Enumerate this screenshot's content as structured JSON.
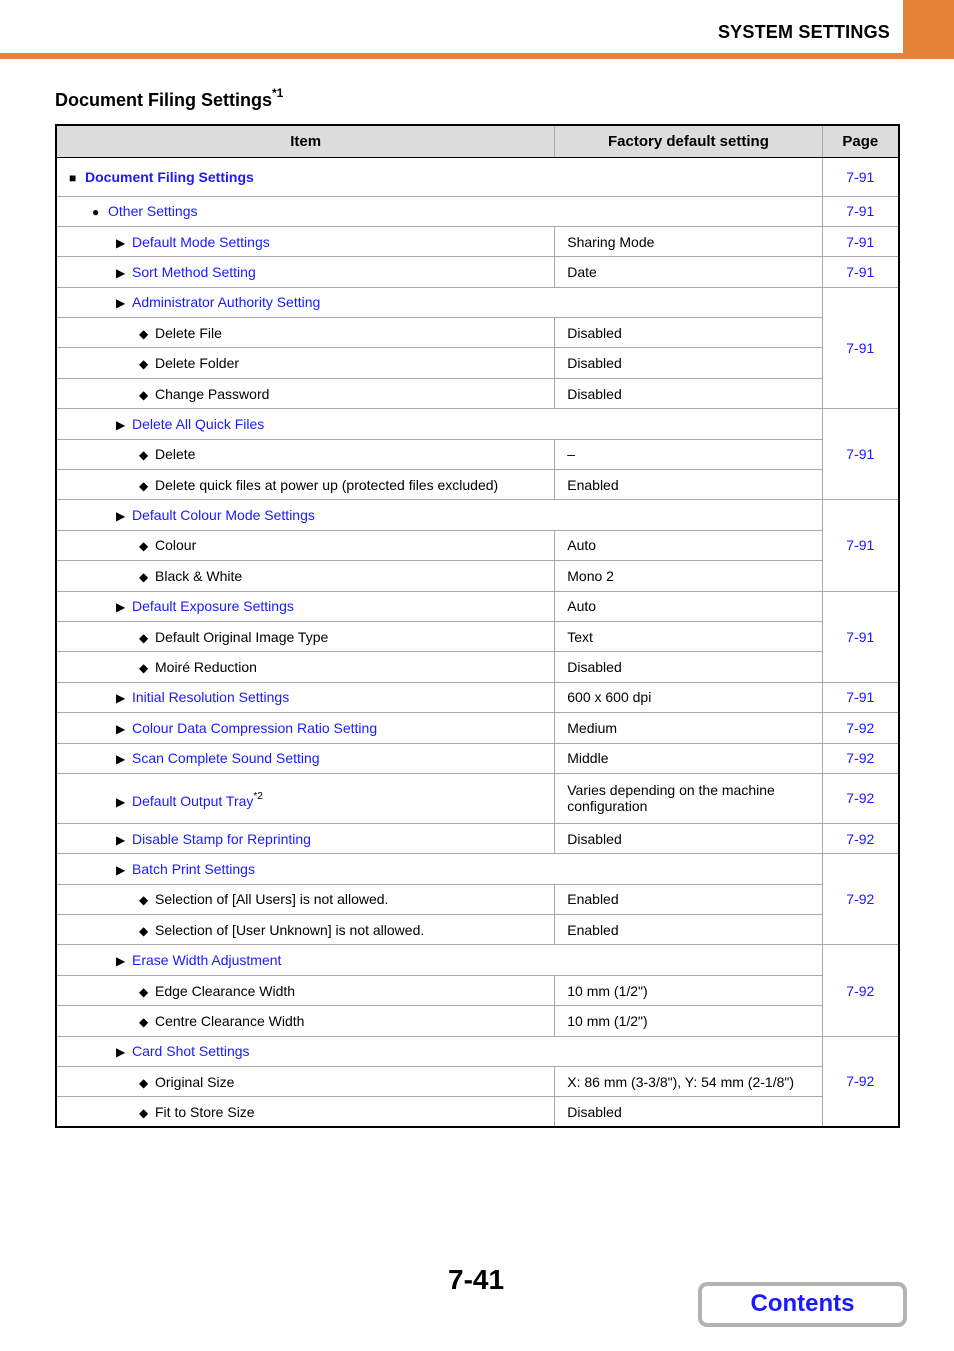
{
  "header": {
    "title": "SYSTEM SETTINGS",
    "accent_color": "#e5823a"
  },
  "section": {
    "title": "Document Filing Settings",
    "footnote_marker": "*1"
  },
  "table": {
    "columns": [
      "Item",
      "Factory default setting",
      "Page"
    ],
    "rows": [
      {
        "bullet": "■",
        "label": "Document Filing Settings",
        "link": true,
        "default": "",
        "page": "7-91"
      },
      {
        "bullet": "●",
        "label": "Other Settings",
        "link": true,
        "default": "",
        "page": "7-91"
      },
      {
        "bullet": "▶",
        "label": "Default Mode Settings",
        "link": true,
        "default": "Sharing Mode",
        "page": "7-91"
      },
      {
        "bullet": "▶",
        "label": "Sort Method Setting",
        "link": true,
        "default": "Date",
        "page": "7-91"
      },
      {
        "bullet": "▶",
        "label": "Administrator Authority Setting",
        "link": true,
        "default": "",
        "page": "7-91"
      },
      {
        "bullet": "◆",
        "label": "Delete File",
        "link": false,
        "default": "Disabled"
      },
      {
        "bullet": "◆",
        "label": "Delete Folder",
        "link": false,
        "default": "Disabled"
      },
      {
        "bullet": "◆",
        "label": "Change Password",
        "link": false,
        "default": "Disabled"
      },
      {
        "bullet": "▶",
        "label": "Delete All Quick Files",
        "link": true,
        "default": "",
        "page": "7-91"
      },
      {
        "bullet": "◆",
        "label": "Delete",
        "link": false,
        "default": "–"
      },
      {
        "bullet": "◆",
        "label": "Delete quick files at power up (protected files excluded)",
        "link": false,
        "default": "Enabled"
      },
      {
        "bullet": "▶",
        "label": "Default Colour Mode Settings",
        "link": true,
        "default": "",
        "page": "7-91"
      },
      {
        "bullet": "◆",
        "label": "Colour",
        "link": false,
        "default": "Auto"
      },
      {
        "bullet": "◆",
        "label": "Black & White",
        "link": false,
        "default": "Mono 2"
      },
      {
        "bullet": "▶",
        "label": "Default Exposure Settings",
        "link": true,
        "default": "Auto",
        "page": "7-91"
      },
      {
        "bullet": "◆",
        "label": "Default Original Image Type",
        "link": false,
        "default": "Text"
      },
      {
        "bullet": "◆",
        "label": "Moiré Reduction",
        "link": false,
        "default": "Disabled"
      },
      {
        "bullet": "▶",
        "label": "Initial Resolution Settings",
        "link": true,
        "default": "600 x 600 dpi",
        "page": "7-91"
      },
      {
        "bullet": "▶",
        "label": "Colour Data Compression Ratio Setting",
        "link": true,
        "default": "Medium",
        "page": "7-92"
      },
      {
        "bullet": "▶",
        "label": "Scan Complete Sound Setting",
        "link": true,
        "default": "Middle",
        "page": "7-92"
      },
      {
        "bullet": "▶",
        "label": "Default Output Tray",
        "link": true,
        "footnote": "*2",
        "default": "Varies depending on the machine configuration",
        "page": "7-92"
      },
      {
        "bullet": "▶",
        "label": "Disable Stamp for Reprinting",
        "link": true,
        "default": "Disabled",
        "page": "7-92"
      },
      {
        "bullet": "▶",
        "label": "Batch Print Settings",
        "link": true,
        "default": "",
        "page": "7-92"
      },
      {
        "bullet": "◆",
        "label": "Selection of [All Users] is not allowed.",
        "link": false,
        "default": "Enabled"
      },
      {
        "bullet": "◆",
        "label": "Selection of [User Unknown] is not allowed.",
        "link": false,
        "default": "Enabled"
      },
      {
        "bullet": "▶",
        "label": "Erase Width Adjustment",
        "link": true,
        "default": "",
        "page": "7-92"
      },
      {
        "bullet": "◆",
        "label": "Edge Clearance Width",
        "link": false,
        "default": "10 mm (1/2\")"
      },
      {
        "bullet": "◆",
        "label": "Centre Clearance Width",
        "link": false,
        "default": "10 mm (1/2\")"
      },
      {
        "bullet": "▶",
        "label": "Card Shot Settings",
        "link": true,
        "default": "",
        "page": "7-92"
      },
      {
        "bullet": "◆",
        "label": "Original Size",
        "link": false,
        "default": "X: 86 mm (3-3/8\"), Y: 54 mm (2-1/8\")"
      },
      {
        "bullet": "◆",
        "label": "Fit to Store Size",
        "link": false,
        "default": "Disabled"
      }
    ]
  },
  "footer": {
    "page_number": "7-41",
    "contents_label": "Contents"
  }
}
